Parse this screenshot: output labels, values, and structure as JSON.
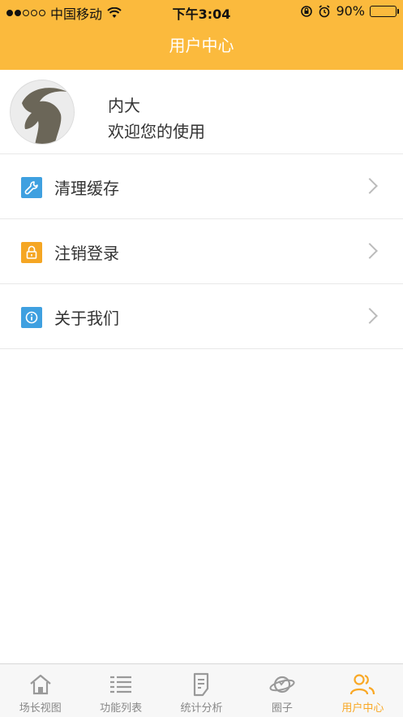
{
  "status_bar": {
    "carrier": "中国移动",
    "time": "下午3:04",
    "battery_percent": "90%",
    "battery_level": 0.9
  },
  "header": {
    "title": "用户中心",
    "color": "#FBBA3D"
  },
  "profile": {
    "name": "内大",
    "welcome": "欢迎您的使用"
  },
  "menu": [
    {
      "label": "清理缓存",
      "icon": "wrench-icon",
      "color": "#3FA0E0"
    },
    {
      "label": "注销登录",
      "icon": "lock-icon",
      "color": "#F5A623"
    },
    {
      "label": "关于我们",
      "icon": "info-icon",
      "color": "#3FA0E0"
    }
  ],
  "tabbar": {
    "items": [
      {
        "label": "场长视图",
        "icon": "home-icon"
      },
      {
        "label": "功能列表",
        "icon": "list-icon"
      },
      {
        "label": "统计分析",
        "icon": "document-icon"
      },
      {
        "label": "圈子",
        "icon": "planet-icon"
      },
      {
        "label": "用户中心",
        "icon": "users-icon",
        "active": true
      }
    ],
    "active_color": "#F9A825",
    "inactive_color": "#888888"
  }
}
